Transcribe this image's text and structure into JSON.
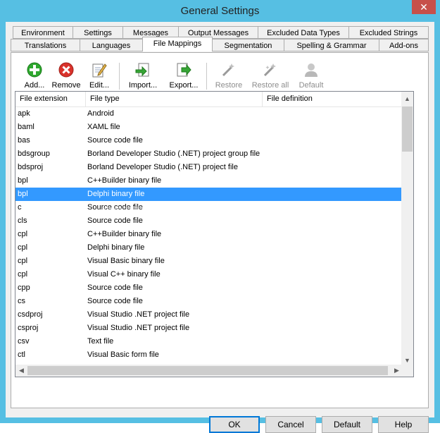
{
  "window": {
    "title": "General Settings",
    "close_glyph": "✕"
  },
  "tabs_row1": [
    "Environment",
    "Settings",
    "Messages",
    "Output Messages",
    "Excluded Data Types",
    "Excluded Strings"
  ],
  "tabs_row2": [
    "Translations",
    "Languages",
    "File Mappings",
    "Segmentation",
    "Spelling & Grammar",
    "Add-ons"
  ],
  "active_tab": "File Mappings",
  "toolbar": {
    "add": "Add...",
    "remove": "Remove",
    "edit": "Edit...",
    "import": "Import...",
    "export": "Export...",
    "restore": "Restore",
    "restore_all": "Restore all",
    "default": "Default"
  },
  "list": {
    "columns": [
      "File extension",
      "File type",
      "File definition"
    ],
    "rows": [
      [
        "apk",
        "Android"
      ],
      [
        "baml",
        "XAML file"
      ],
      [
        "bas",
        "Source code file"
      ],
      [
        "bdsgroup",
        "Borland Developer Studio (.NET) project group file"
      ],
      [
        "bdsproj",
        "Borland Developer Studio (.NET) project file"
      ],
      [
        "bpl",
        "C++Builder binary file"
      ],
      [
        "bpl",
        "Delphi binary file"
      ],
      [
        "c",
        "Source code file"
      ],
      [
        "cls",
        "Source code file"
      ],
      [
        "cpl",
        "C++Builder binary file"
      ],
      [
        "cpl",
        "Delphi binary file"
      ],
      [
        "cpl",
        "Visual Basic binary file"
      ],
      [
        "cpl",
        "Visual C++ binary file"
      ],
      [
        "cpp",
        "Source code file"
      ],
      [
        "cs",
        "Source code file"
      ],
      [
        "csdproj",
        "Visual Studio .NET project file"
      ],
      [
        "csproj",
        "Visual Studio .NET project file"
      ],
      [
        "csv",
        "Text file"
      ],
      [
        "ctl",
        "Visual Basic form file"
      ]
    ],
    "selected_index": 6
  },
  "watermark": "SOFTPEDIA",
  "buttons": {
    "ok": "OK",
    "cancel": "Cancel",
    "default": "Default",
    "help": "Help"
  },
  "colors": {
    "selection": "#3399ff",
    "titlebar": "#56bfe3",
    "close": "#c7504a"
  }
}
